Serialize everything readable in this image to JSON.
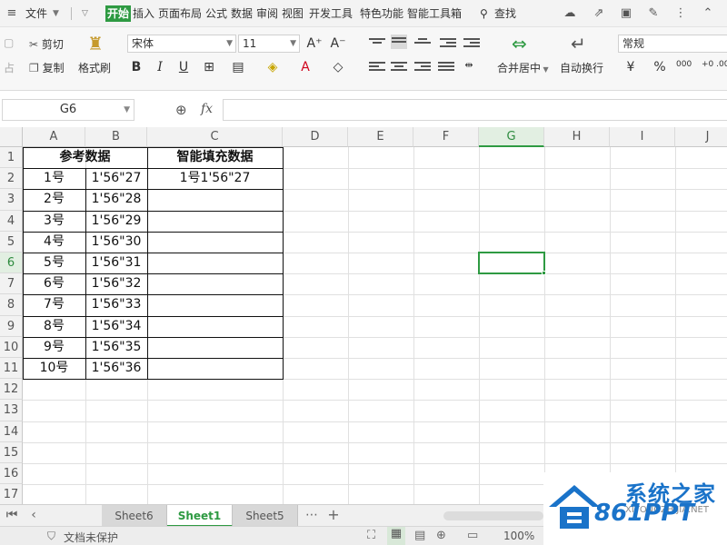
{
  "menu": {
    "file": "文件",
    "tabs": [
      "开始",
      "插入",
      "页面布局",
      "公式",
      "数据",
      "审阅",
      "视图",
      "开发工具",
      "特色功能",
      "智能工具箱"
    ],
    "active_tab": "开始",
    "search": "查找"
  },
  "ribbon": {
    "cut": "剪切",
    "copy": "复制",
    "format_painter": "格式刷",
    "paste_hint": "占",
    "font_name": "宋体",
    "font_size": "11",
    "merge_center": "合并居中",
    "wrap_text": "自动换行",
    "number_format": "常规",
    "bold": "B",
    "italic": "I",
    "underline": "U",
    "percent": "%",
    "thousands": "000",
    "decimal": "+0 .00"
  },
  "formula_bar": {
    "name_box": "G6",
    "fx": "fx",
    "formula": ""
  },
  "columns": [
    "A",
    "B",
    "C",
    "D",
    "E",
    "F",
    "G",
    "H",
    "I",
    "J"
  ],
  "selected_column": "G",
  "rows": [
    "1",
    "2",
    "3",
    "4",
    "5",
    "6",
    "7",
    "8",
    "9",
    "10",
    "11",
    "12",
    "13",
    "14",
    "15",
    "16",
    "17"
  ],
  "selected_row": "6",
  "table": {
    "header_ref": "参考数据",
    "header_fill": "智能填充数据",
    "a": [
      "1号",
      "2号",
      "3号",
      "4号",
      "5号",
      "6号",
      "7号",
      "8号",
      "9号",
      "10号"
    ],
    "b": [
      "1'56\"27",
      "1'56\"28",
      "1'56\"29",
      "1'56\"30",
      "1'56\"31",
      "1'56\"32",
      "1'56\"33",
      "1'56\"34",
      "1'56\"35",
      "1'56\"36"
    ],
    "c2": "1号1'56\"27"
  },
  "sheets": [
    "Sheet6",
    "Sheet1",
    "Sheet5"
  ],
  "active_sheet": "Sheet1",
  "status": {
    "protect": "文档未保护",
    "zoom": "100%"
  },
  "watermark": {
    "title": "系统之家",
    "sub": "861PPT",
    "small": "XITONGZHIJIA.NET"
  },
  "colors": {
    "accent": "#2e9a42",
    "watermark_blue": "#1a73c9"
  }
}
